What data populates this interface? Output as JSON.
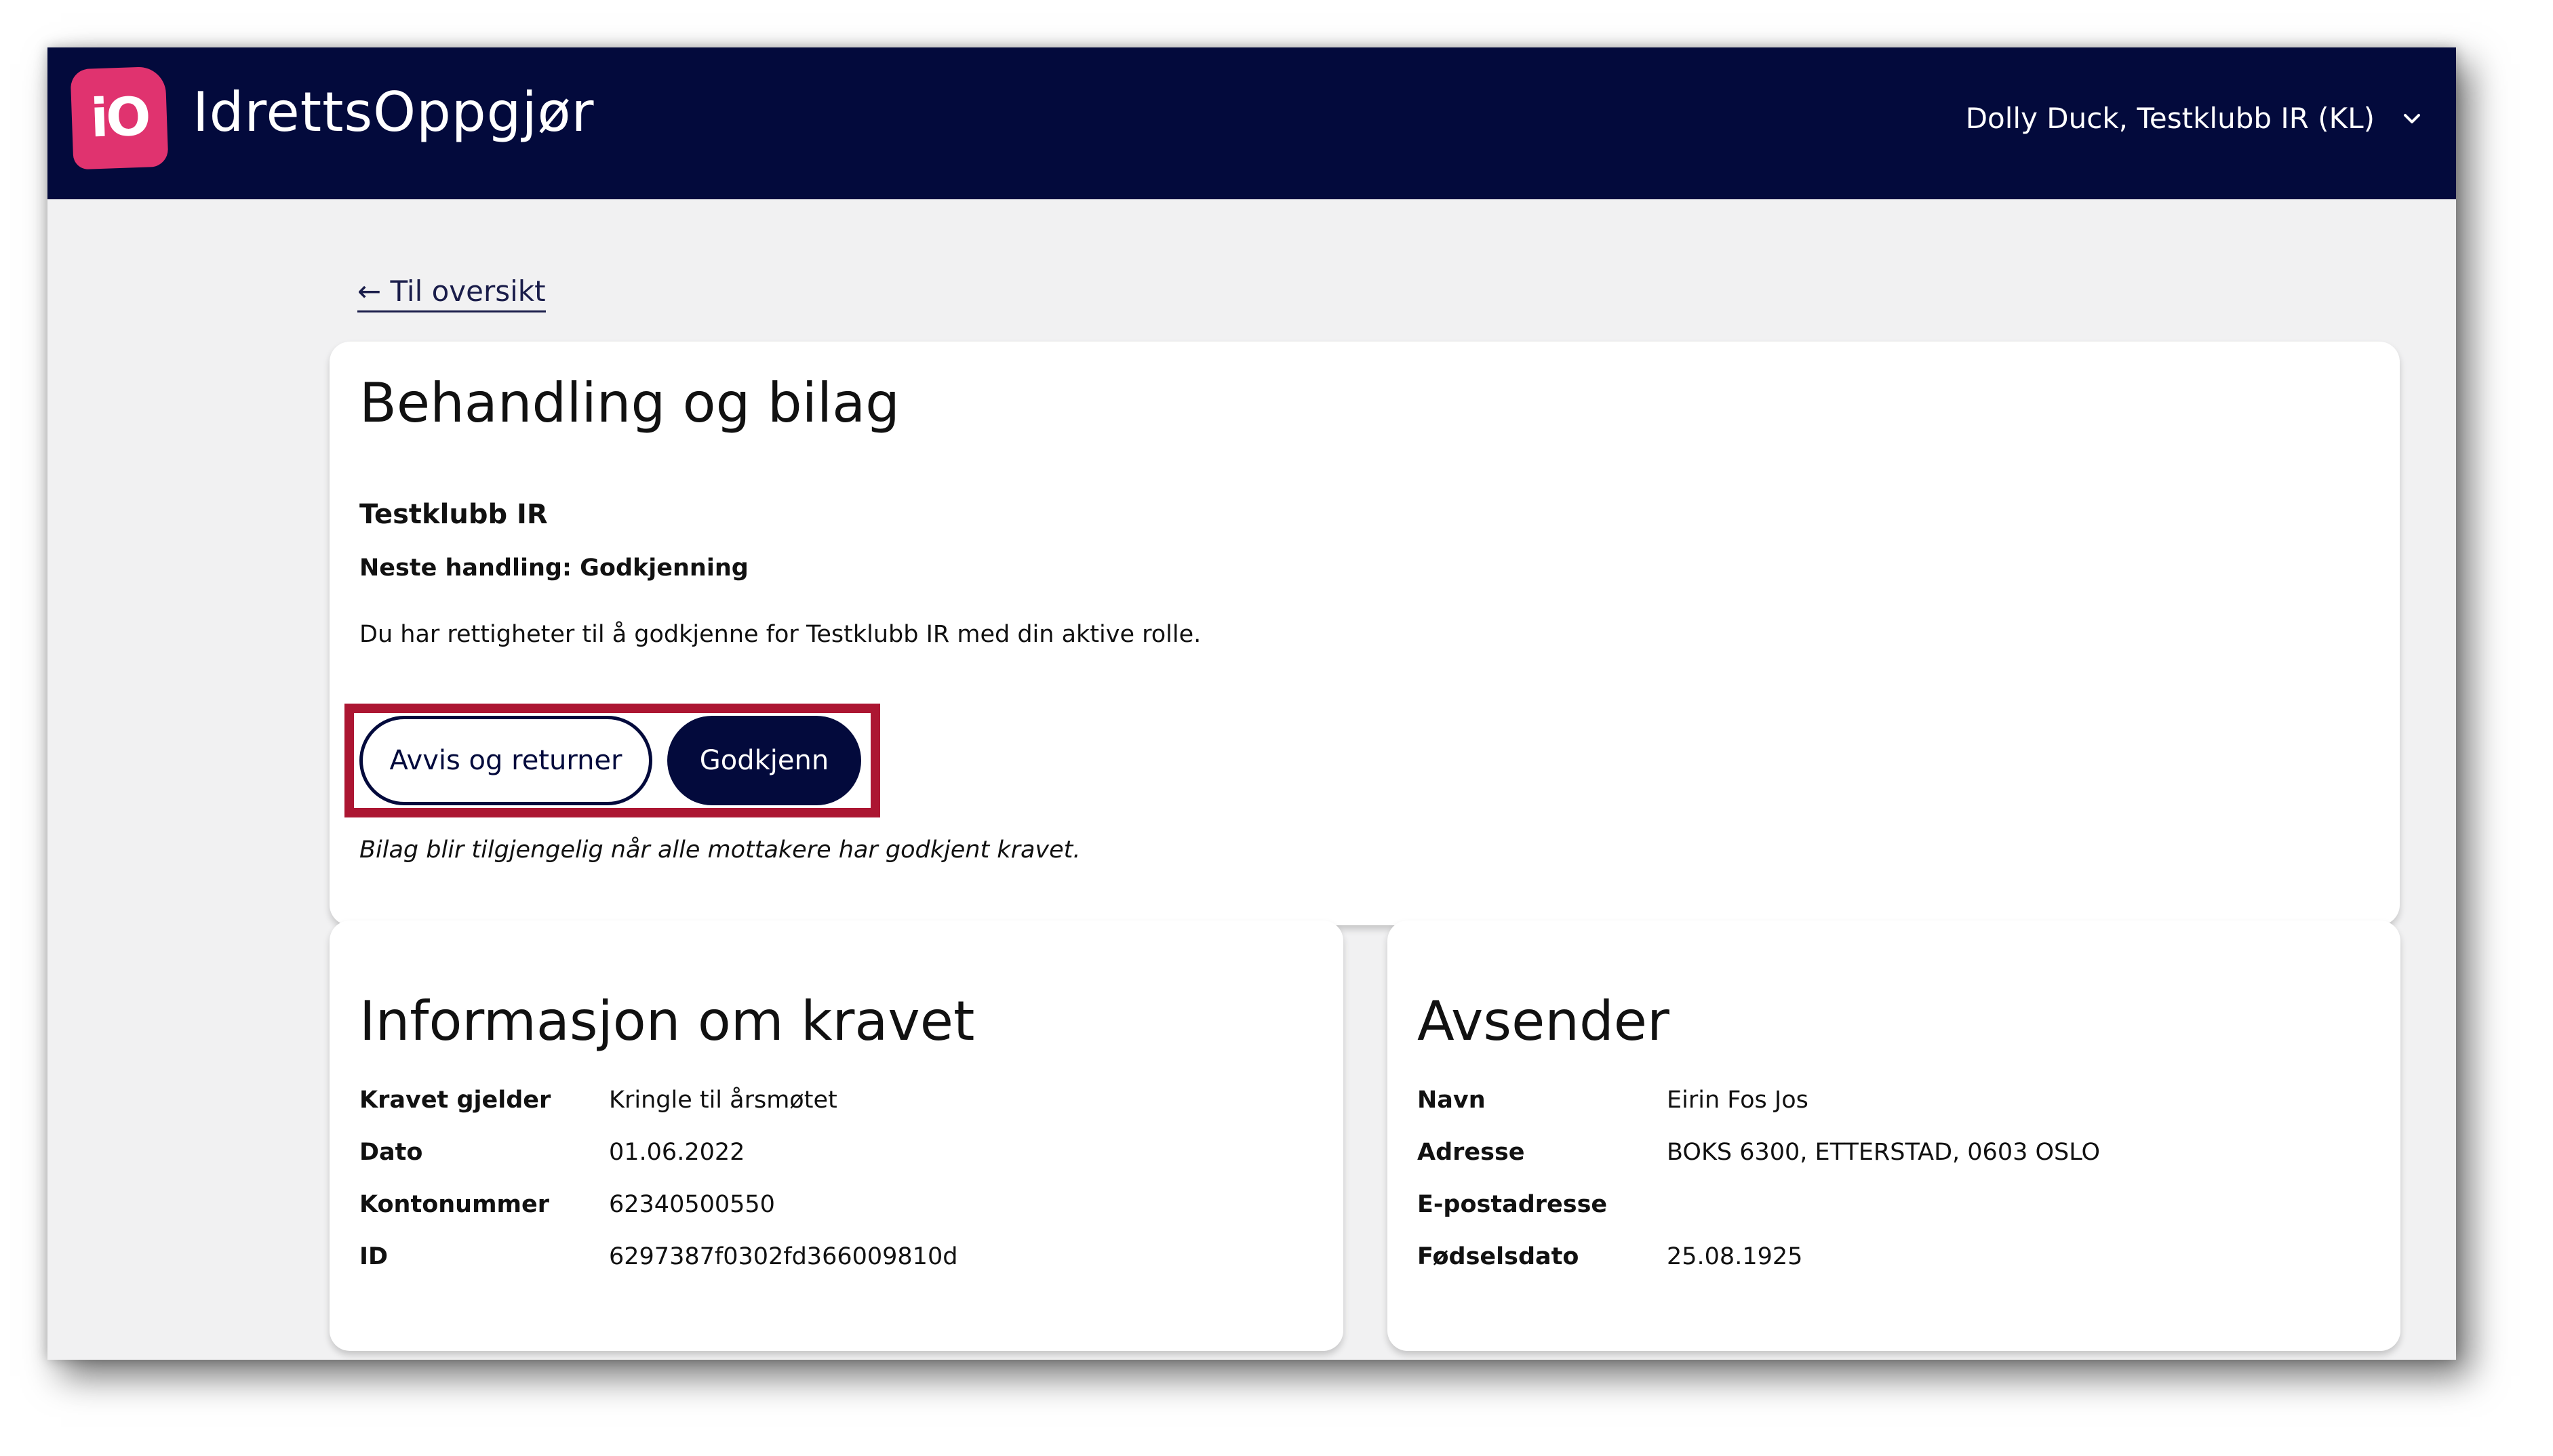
{
  "header": {
    "logo_text": "iO",
    "app_title": "IdrettsOppgjør",
    "user_label": "Dolly Duck, Testklubb IR (KL)",
    "user_menu_icon": "chevron-down-icon"
  },
  "nav": {
    "back_link": "← Til oversikt"
  },
  "main": {
    "title": "Behandling og bilag",
    "club": "Testklubb IR",
    "next_action": "Neste handling: Godkjenning",
    "rights_text": "Du har rettigheter til å godkjenne for Testklubb IR med din aktive rolle.",
    "reject_button": "Avvis og returner",
    "approve_button": "Godkjenn",
    "note": "Bilag blir tilgjengelig når alle mottakere har godkjent kravet.",
    "highlight_color": "#ac1632"
  },
  "info": {
    "title": "Informasjon om kravet",
    "rows": [
      {
        "label": "Kravet gjelder",
        "value": "Kringle til årsmøtet"
      },
      {
        "label": "Dato",
        "value": "01.06.2022"
      },
      {
        "label": "Kontonummer",
        "value": "62340500550"
      },
      {
        "label": "ID",
        "value": "6297387f0302fd366009810d"
      }
    ]
  },
  "sender": {
    "title": "Avsender",
    "rows": [
      {
        "label": "Navn",
        "value": "Eirin Fos Jos"
      },
      {
        "label": "Adresse",
        "value": "BOKS 6300, ETTERSTAD, 0603 OSLO"
      },
      {
        "label": "E-postadresse",
        "value": ""
      },
      {
        "label": "Fødselsdato",
        "value": "25.08.1925"
      }
    ]
  },
  "colors": {
    "navy": "#030a3c",
    "brand_pink": "#e0336f",
    "background": "#f1f1f2"
  }
}
